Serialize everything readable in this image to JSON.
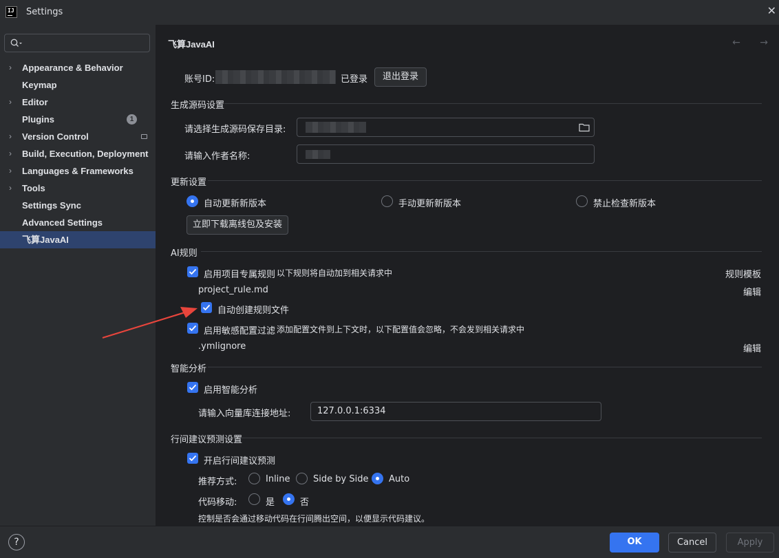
{
  "window": {
    "title": "Settings",
    "logo_text": "IJ"
  },
  "search": {
    "placeholder": ""
  },
  "sidebar": {
    "items": [
      {
        "label": "Appearance & Behavior",
        "expandable": true
      },
      {
        "label": "Keymap",
        "expandable": false
      },
      {
        "label": "Editor",
        "expandable": true
      },
      {
        "label": "Plugins",
        "expandable": false,
        "badge": "1"
      },
      {
        "label": "Version Control",
        "expandable": true
      },
      {
        "label": "Build, Execution, Deployment",
        "expandable": true
      },
      {
        "label": "Languages & Frameworks",
        "expandable": true
      },
      {
        "label": "Tools",
        "expandable": true
      },
      {
        "label": "Settings Sync",
        "expandable": false
      },
      {
        "label": "Advanced Settings",
        "expandable": false
      },
      {
        "label": "飞算JavaAI",
        "expandable": false,
        "selected": true
      }
    ]
  },
  "page": {
    "title": "飞算JavaAI",
    "nav_arrows": "← →",
    "account": {
      "id_label": "账号ID:",
      "status": "已登录",
      "logout_button": "退出登录"
    },
    "source_gen": {
      "title": "生成源码设置",
      "dir_label": "请选择生成源码保存目录:",
      "author_label": "请输入作者名称:"
    },
    "update": {
      "title": "更新设置",
      "options": [
        "自动更新新版本",
        "手动更新新版本",
        "禁止检查新版本"
      ],
      "selected": "自动更新新版本",
      "download_button": "立即下载离线包及安装"
    },
    "ai_rules": {
      "title": "AI规则",
      "project_rules": {
        "label": "启用项目专属规则",
        "hint": "以下规则将自动加到相关请求中",
        "checked": true,
        "link": "规则模板"
      },
      "rule_file": "project_rule.md",
      "edit_label": "编辑",
      "auto_create": {
        "label": "自动创建规则文件",
        "checked": true
      },
      "sensitive": {
        "label": "启用敏感配置过滤",
        "hint": "添加配置文件到上下文时，以下配置值会忽略，不会发到相关请求中",
        "checked": true
      },
      "ignore_file": ".ymlignore",
      "edit_label_2": "编辑"
    },
    "analysis": {
      "title": "智能分析",
      "enable": {
        "label": "启用智能分析",
        "checked": true
      },
      "vector_db_label": "请输入向量库连接地址:",
      "vector_db_value": "127.0.0.1:6334"
    },
    "inline": {
      "title": "行间建议预测设置",
      "enable": {
        "label": "开启行间建议预测",
        "checked": true
      },
      "mode_label": "推荐方式:",
      "modes": [
        "Inline",
        "Side by Side",
        "Auto"
      ],
      "mode_selected": "Auto",
      "move_label": "代码移动:",
      "move_options": [
        "是",
        "否"
      ],
      "move_selected": "否",
      "move_hint": "控制是否会通过移动代码在行间腾出空间，以便显示代码建议。"
    }
  },
  "footer": {
    "help": "?",
    "ok": "OK",
    "cancel": "Cancel",
    "apply": "Apply"
  },
  "colors": {
    "accent": "#3574f0",
    "success": "#5fb865",
    "link": "#548af7",
    "annotation_arrow": "#e8453c"
  }
}
